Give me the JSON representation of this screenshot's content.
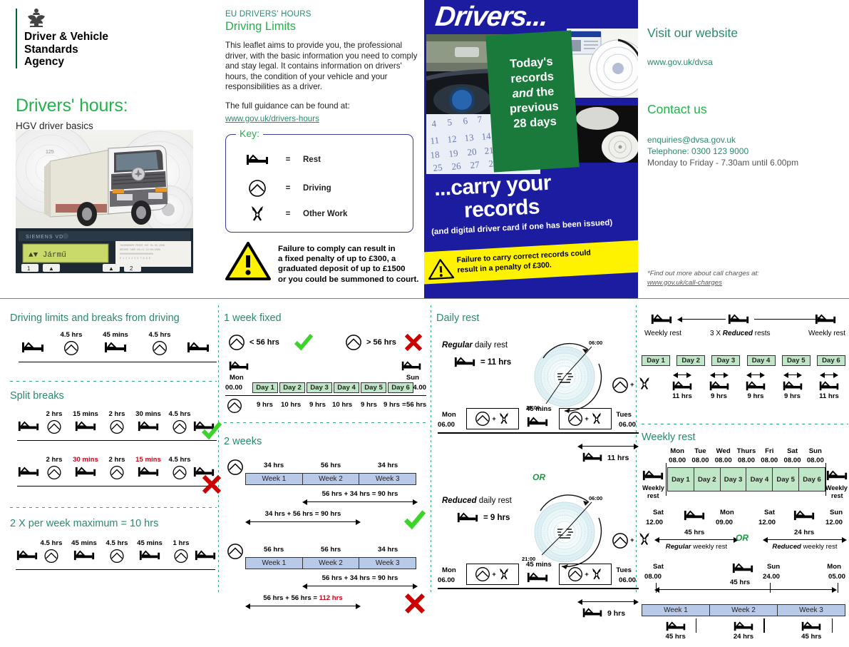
{
  "brand": {
    "organisation": "Driver & Vehicle\nStandards\nAgency",
    "org_line1": "Driver & Vehicle",
    "org_line2": "Standards",
    "org_line3": "Agency",
    "title": "Drivers' hours:",
    "subtitle": "HGV driver basics",
    "green": "#24b24b",
    "teal": "#2a8a6e",
    "blue": "#1c1ca0",
    "yellow": "#fff200",
    "red": "#c00"
  },
  "intro": {
    "eyebrow": "EU DRIVERS' HOURS",
    "heading": "Driving Limits",
    "paragraph": "This leaflet aims to provide you, the professional driver, with the basic information you need to comply and stay legal. It contains information on drivers' hours, the condition of your vehicle and your responsibilities as a driver.",
    "guidance_lead": "The full guidance can be found at:",
    "guidance_link": "www.gov.uk/drivers-hours"
  },
  "key": {
    "label": "Key:",
    "equals": "=",
    "rows": [
      {
        "icon": "bed-icon",
        "label": "Rest"
      },
      {
        "icon": "driving-icon",
        "label": "Driving"
      },
      {
        "icon": "other-work-icon",
        "label": "Other Work"
      }
    ]
  },
  "warning": {
    "text": "Failure to comply can result in a fixed penalty of up to £300, a graduated deposit of up to £1500 or you could be summoned to court.",
    "line1": "Failure to comply can result in",
    "line2a": "a fixed penalty of up to ",
    "line2b": "£300",
    "line2c": ", a",
    "line3a": "graduated deposit of up to ",
    "line3b": "£1500",
    "line4": "or you could be summoned to court."
  },
  "poster": {
    "headline_top": "Drivers...",
    "green_tile": "Today's records and the previous 28 days",
    "green_tile_l1": "Today's",
    "green_tile_l2": "records",
    "green_tile_l3a": "and",
    "green_tile_l3b": " the",
    "green_tile_l4": "previous",
    "green_tile_l5": "28 days",
    "carry_l1": "...carry your",
    "carry_l2": "records",
    "carry_sub": "(and digital driver card if one has been issued)",
    "warn_l1": "Failure to carry correct records could",
    "warn_l2a": "result in a penalty of ",
    "warn_l2b": "£300",
    "warn_l2c": "."
  },
  "contact": {
    "website_heading": "Visit our website",
    "website_url": "www.gov.uk/dvsa",
    "contact_heading": "Contact us",
    "email": "enquiries@dvsa.gov.uk",
    "telephone": "Telephone: 0300 123 9000",
    "hours": "Monday to Friday - 7.30am until 6.00pm",
    "footnote_line1": "*Find out more about call charges at:",
    "footnote_link": "www.gov.uk/call-charges"
  },
  "driving_limits": {
    "title": "Driving limits and breaks from driving",
    "sequence": {
      "labels": [
        "4.5 hrs",
        "45 mins",
        "4.5 hrs"
      ],
      "icons": [
        "bed-icon",
        "driving-icon",
        "bed-icon",
        "driving-icon",
        "bed-icon"
      ]
    }
  },
  "split_breaks": {
    "title": "Split breaks",
    "row_ok": {
      "labels": [
        "2 hrs",
        "15 mins",
        "2 hrs",
        "30 mins",
        "4.5 hrs"
      ],
      "label_colors": [
        "black",
        "black",
        "black",
        "black",
        "black"
      ],
      "verdict": "tick"
    },
    "row_bad": {
      "labels": [
        "2 hrs",
        "30 mins",
        "2 hrs",
        "15 mins",
        "4.5 hrs"
      ],
      "label_colors": [
        "black",
        "red",
        "black",
        "red",
        "black"
      ],
      "verdict": "cross"
    }
  },
  "ten_hours": {
    "title": "2 X per week maximum = 10 hrs",
    "labels": [
      "4.5 hrs",
      "45 mins",
      "4.5 hrs",
      "45 mins",
      "1 hrs"
    ]
  },
  "one_week_fixed": {
    "title": "1 week fixed",
    "ok_text": "< 56 hrs",
    "bad_text": "> 56 hrs",
    "start_day": "Mon",
    "start_time": "00.00",
    "end_day": "Sun",
    "end_time": "24.00",
    "days": [
      "Day 1",
      "Day 2",
      "Day 3",
      "Day 4",
      "Day 5",
      "Day 6"
    ],
    "hours": [
      "9 hrs",
      "10 hrs",
      "9 hrs",
      "10 hrs",
      "9 hrs",
      "9 hrs"
    ],
    "total_eq": "=",
    "total": "56 hrs"
  },
  "two_weeks": {
    "title": "2 weeks",
    "case_ok": {
      "week_hours": [
        "34 hrs",
        "56 hrs",
        "34 hrs"
      ],
      "weeks": [
        "Week 1",
        "Week 2",
        "Week 3"
      ],
      "sum_top_a": "56 hrs + 34 hrs = ",
      "sum_top_b": "90 hrs",
      "sum_bottom_a": "34 hrs + 56 hrs = ",
      "sum_bottom_b": "90 hrs",
      "verdict": "tick"
    },
    "case_bad": {
      "week_hours": [
        "56 hrs",
        "56 hrs",
        "34 hrs"
      ],
      "weeks": [
        "Week 1",
        "Week 2",
        "Week 3"
      ],
      "sum_top_a": "56 hrs + 34 hrs = ",
      "sum_top_b": "90 hrs",
      "sum_bottom_a": "56 hrs + 56 hrs = ",
      "sum_bottom_b": "112 hrs",
      "verdict": "cross"
    }
  },
  "daily_rest": {
    "title": "Daily rest",
    "or": "OR",
    "regular": {
      "label_em": "Regular",
      "label_rest": " daily rest",
      "equals": "= 11 hrs",
      "dial_top": "06:00",
      "dial_bottom": "19:00",
      "start_day": "Mon",
      "start_time": "06.00",
      "break_label": "45 mins",
      "end_day": "Tues",
      "end_time": "06.00",
      "rest_amount": "11 hrs",
      "plus": "+"
    },
    "reduced": {
      "label_em": "Reduced",
      "label_rest": " daily rest",
      "equals": "= 9 hrs",
      "dial_top": "06:00",
      "dial_bottom": "21:00",
      "start_day": "Mon",
      "start_time": "06.00",
      "break_label": "45 mins",
      "end_day": "Tues",
      "end_time": "06.00",
      "rest_amount": "9 hrs",
      "plus": "+"
    }
  },
  "reduced_rests": {
    "left_label": "Weekly rest",
    "centre_a": "3 X ",
    "centre_b": "Reduced",
    "centre_c": " rests",
    "right_label": "Weekly rest",
    "days": [
      "Day 1",
      "Day 2",
      "Day 3",
      "Day 4",
      "Day 5",
      "Day 6"
    ],
    "rest_hours": [
      "11 hrs",
      "9 hrs",
      "9 hrs",
      "9 hrs",
      "11 hrs"
    ]
  },
  "weekly_rest": {
    "title": "Weekly rest",
    "day_names": [
      "Mon",
      "Tue",
      "Wed",
      "Thurs",
      "Fri",
      "Sat",
      "Sun"
    ],
    "day_times": [
      "08.00",
      "08.00",
      "08.00",
      "08.00",
      "08.00",
      "08.00",
      "08.00"
    ],
    "days": [
      "Day 1",
      "Day 2",
      "Day 3",
      "Day 4",
      "Day 5",
      "Day 6"
    ],
    "left_label_l1": "Weekly",
    "left_label_l2": "rest",
    "right_label_l1": "Weekly",
    "right_label_l2": "rest",
    "regular": {
      "start_day": "Sat",
      "start_time": "12.00",
      "amount": "45 hrs",
      "end_day": "Mon",
      "end_time": "09.00",
      "caption_em": "Regular",
      "caption_rest": " weekly rest"
    },
    "or": "OR",
    "reduced": {
      "start_day": "Sat",
      "start_time": "12.00",
      "amount": "24 hrs",
      "end_day": "Sun",
      "end_time": "12.00",
      "caption_em": "Reduced",
      "caption_rest": " weekly rest"
    },
    "span": {
      "start_day": "Sat",
      "start_time": "08.00",
      "amount": "45 hrs",
      "mid_day": "Sun",
      "mid_time": "24.00",
      "end_day": "Mon",
      "end_time": "05.00"
    },
    "weeks": [
      "Week 1",
      "Week 2",
      "Week 3"
    ],
    "week_rests": [
      "45 hrs",
      "24 hrs",
      "45 hrs"
    ]
  }
}
